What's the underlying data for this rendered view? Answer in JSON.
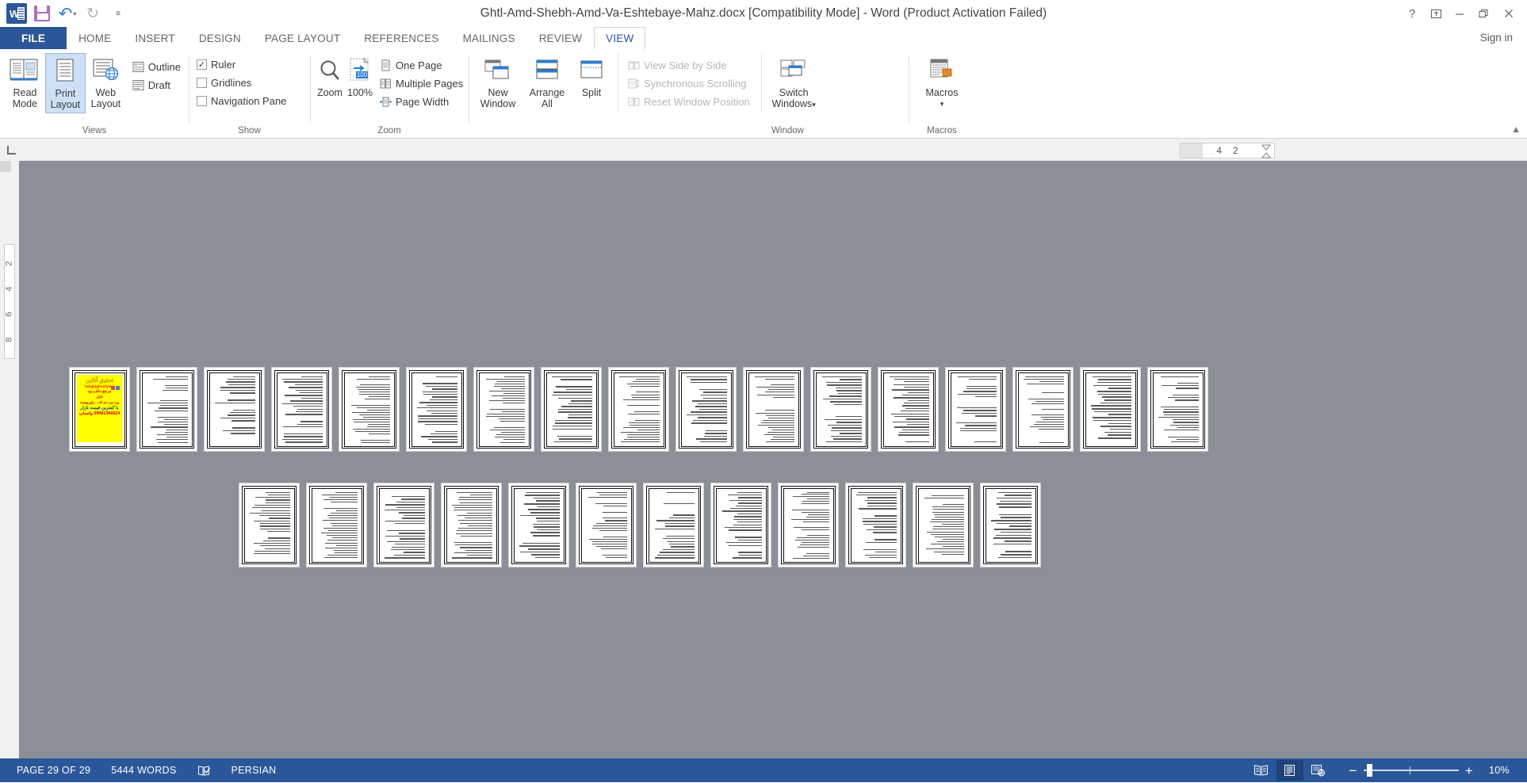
{
  "window": {
    "title": "Ghtl-Amd-Shebh-Amd-Va-Eshtebaye-Mahz.docx [Compatibility Mode] - Word (Product Activation Failed)",
    "help_icon": "question-mark-icon",
    "ribbon_display_icon": "ribbon-display-options-icon",
    "minimize_icon": "minimize-icon",
    "restore_icon": "restore-icon",
    "close_icon": "close-icon",
    "signin_label": "Sign in"
  },
  "quick_access": {
    "app_icon": "word-logo-icon",
    "save_icon": "save-icon",
    "undo_icon": "undo-icon",
    "undo_caret": "▾",
    "redo_icon": "redo-icon",
    "customize_icon": "≡"
  },
  "tabs": [
    {
      "label": "FILE",
      "active": false,
      "file": true
    },
    {
      "label": "HOME",
      "active": false
    },
    {
      "label": "INSERT",
      "active": false
    },
    {
      "label": "DESIGN",
      "active": false
    },
    {
      "label": "PAGE LAYOUT",
      "active": false
    },
    {
      "label": "REFERENCES",
      "active": false
    },
    {
      "label": "MAILINGS",
      "active": false
    },
    {
      "label": "REVIEW",
      "active": false
    },
    {
      "label": "VIEW",
      "active": true
    }
  ],
  "ribbon": {
    "collapse_icon": "▲",
    "groups": [
      {
        "name": "views",
        "label": "Views",
        "big_buttons": [
          {
            "label_top": "Read",
            "label_bottom": "Mode",
            "icon": "read-mode-icon",
            "selected": false
          },
          {
            "label_top": "Print",
            "label_bottom": "Layout",
            "icon": "print-layout-icon",
            "selected": true
          },
          {
            "label_top": "Web",
            "label_bottom": "Layout",
            "icon": "web-layout-icon",
            "selected": false
          }
        ],
        "small_items": [
          {
            "label": "Outline",
            "icon": "outline-icon"
          },
          {
            "label": "Draft",
            "icon": "draft-icon"
          }
        ]
      },
      {
        "name": "show",
        "label": "Show",
        "checkboxes": [
          {
            "label": "Ruler",
            "checked": true
          },
          {
            "label": "Gridlines",
            "checked": false
          },
          {
            "label": "Navigation Pane",
            "checked": false
          }
        ]
      },
      {
        "name": "zoom",
        "label": "Zoom",
        "big_buttons": [
          {
            "label_top": "Zoom",
            "label_bottom": "",
            "icon": "magnifier-icon",
            "selected": false
          },
          {
            "label_top": "100%",
            "label_bottom": "",
            "icon": "zoom-100-icon",
            "selected": false
          }
        ],
        "small_items": [
          {
            "label": "One Page",
            "icon": "one-page-icon"
          },
          {
            "label": "Multiple Pages",
            "icon": "multiple-pages-icon"
          },
          {
            "label": "Page Width",
            "icon": "page-width-icon"
          }
        ]
      },
      {
        "name": "window",
        "label": "Window",
        "big_buttons": [
          {
            "label_top": "New",
            "label_bottom": "Window",
            "icon": "new-window-icon",
            "selected": false
          },
          {
            "label_top": "Arrange",
            "label_bottom": "All",
            "icon": "arrange-all-icon",
            "selected": false
          },
          {
            "label_top": "Split",
            "label_bottom": "",
            "icon": "split-icon",
            "selected": false
          }
        ],
        "small_items": [
          {
            "label": "View Side by Side",
            "icon": "view-side-by-side-icon",
            "disabled": true
          },
          {
            "label": "Synchronous Scrolling",
            "icon": "synchronous-scrolling-icon",
            "disabled": true
          },
          {
            "label": "Reset Window Position",
            "icon": "reset-window-position-icon",
            "disabled": true
          }
        ],
        "switch_windows": {
          "label_top": "Switch",
          "label_bottom": "Windows",
          "caret": "▾",
          "icon": "switch-windows-icon"
        }
      },
      {
        "name": "macros",
        "label": "Macros",
        "big_buttons": [
          {
            "label_top": "Macros",
            "label_bottom": "▾",
            "icon": "macros-icon",
            "selected": false
          }
        ]
      }
    ]
  },
  "ruler": {
    "tab_selector_icon": "left-tab-stop-icon",
    "horizontal_marks": [
      "4",
      "2"
    ],
    "vertical_marks": [
      "2",
      "4",
      "6",
      "8"
    ]
  },
  "document": {
    "ad_page": {
      "title": "تحقیق آنلاین",
      "site": "Tahghighonline.ir",
      "line1": "مرجع دانلــــود",
      "line2": "فایل",
      "line3": "ورد-پی دی اف - پاورپوینت",
      "line4": "با کمترین قیمت بازار",
      "line5": "09981366624 واتساپ"
    },
    "row1_page_count": 17,
    "row2_page_count": 12,
    "total_pages": 29
  },
  "status_bar": {
    "page_label": "PAGE 29 OF 29",
    "word_count": "5444 WORDS",
    "proofing_icon": "proofing-errors-icon",
    "language": "PERSIAN",
    "view_buttons": [
      {
        "name": "read-mode-view",
        "icon": "read-mode-view-icon",
        "active": false
      },
      {
        "name": "print-layout-view",
        "icon": "print-layout-view-icon",
        "active": true
      },
      {
        "name": "web-layout-view",
        "icon": "web-layout-view-icon",
        "active": false
      }
    ],
    "zoom_out_icon": "−",
    "zoom_in_icon": "+",
    "zoom_level": "10%"
  }
}
